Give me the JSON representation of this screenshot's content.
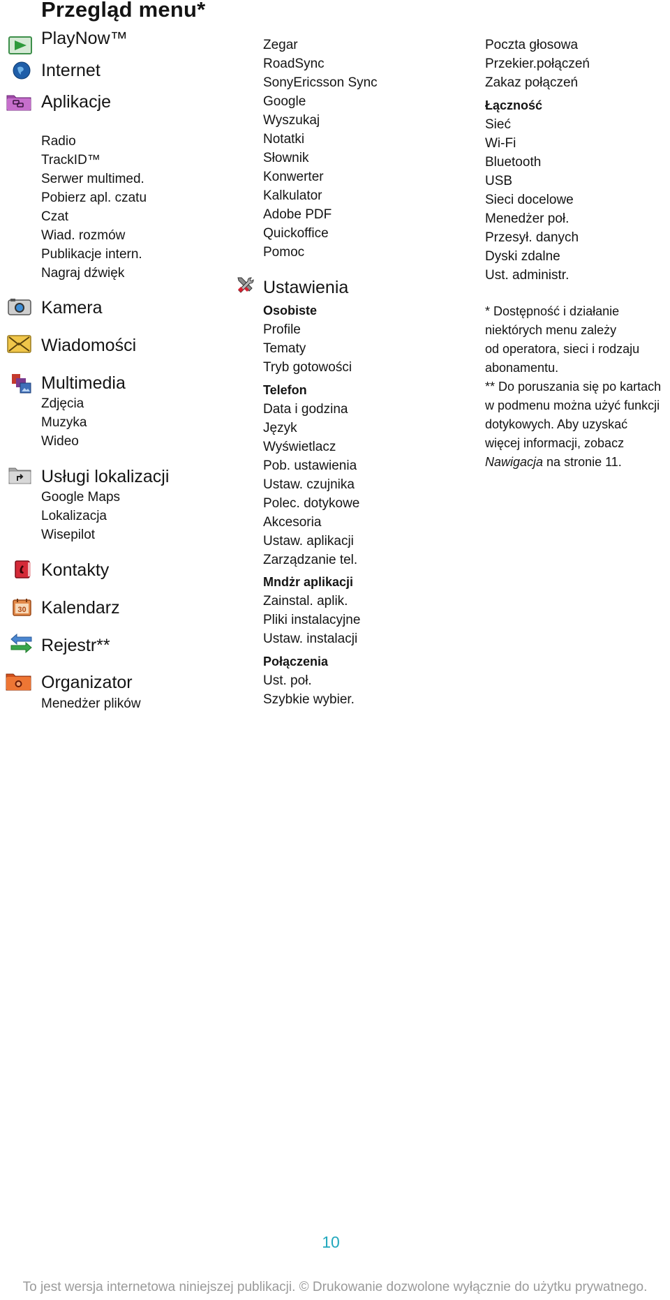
{
  "page": {
    "title": "Przegląd menu*",
    "page_number": "10",
    "footer": "To jest wersja internetowa niniejszej publikacji. © Drukowanie dozwolone wyłącznie do użytku prywatnego."
  },
  "menu": {
    "playnow": {
      "label": "PlayNow™",
      "icon": "playnow-icon"
    },
    "internet": {
      "label": "Internet",
      "icon": "globe-icon"
    },
    "aplikacje": {
      "label": "Aplikacje",
      "icon": "applications-folder-icon",
      "items": [
        "Radio",
        "TrackID™",
        "Serwer multimed.",
        "Pobierz apl. czatu",
        "Czat",
        "Wiad. rozmów",
        "Publikacje intern.",
        "Nagraj dźwięk",
        "Zegar",
        "RoadSync",
        "SonyEricsson Sync",
        "Google",
        "Wyszukaj",
        "Notatki",
        "Słownik",
        "Konwerter",
        "Kalkulator",
        "Adobe PDF",
        "Quickoffice",
        "Pomoc"
      ]
    },
    "kamera": {
      "label": "Kamera",
      "icon": "camera-icon"
    },
    "wiadomosci": {
      "label": "Wiadomości",
      "icon": "envelope-icon"
    },
    "multimedia": {
      "label": "Multimedia",
      "icon": "multimedia-icon",
      "items": [
        "Zdjęcia",
        "Muzyka",
        "Wideo"
      ]
    },
    "uslugi": {
      "label": "Usługi lokalizacji",
      "icon": "location-folder-icon",
      "items": [
        "Google Maps",
        "Lokalizacja",
        "Wisepilot"
      ]
    },
    "kontakty": {
      "label": "Kontakty",
      "icon": "phonebook-icon"
    },
    "kalendarz": {
      "label": "Kalendarz",
      "icon": "calendar-icon",
      "icon_text": "30"
    },
    "rejestr": {
      "label": "Rejestr**",
      "icon": "arrows-exchange-icon"
    },
    "organizator": {
      "label": "Organizator",
      "icon": "organizer-folder-icon",
      "items": [
        "Menedżer plików"
      ]
    },
    "ustawienia": {
      "label": "Ustawienia",
      "icon": "tools-icon",
      "groups": [
        {
          "heading": "Osobiste",
          "items": [
            "Profile",
            "Tematy",
            "Tryb gotowości"
          ]
        },
        {
          "heading": "Telefon",
          "items": [
            "Data i godzina",
            "Język",
            "Wyświetlacz",
            "Pob. ustawienia",
            "Ustaw. czujnika",
            "Polec. dotykowe",
            "Akcesoria",
            "Ustaw. aplikacji",
            "Zarządzanie tel."
          ]
        },
        {
          "heading": "Mndżr aplikacji",
          "items": [
            "Zainstal. aplik.",
            "Pliki instalacyjne",
            "Ustaw. instalacji"
          ]
        },
        {
          "heading": "Połączenia",
          "items": [
            "Ust. poł.",
            "Szybkie wybier.",
            "Poczta głosowa",
            "Przekier.połączeń",
            "Zakaz połączeń"
          ]
        },
        {
          "heading": "Łączność",
          "items": [
            "Sieć",
            "Wi-Fi",
            "Bluetooth",
            "USB",
            "Sieci docelowe",
            "Menedżer poł.",
            "Przesył. danych",
            "Dyski zdalne",
            "Ust. administr."
          ]
        }
      ]
    }
  },
  "notes": {
    "note1": [
      "* Dostępność i działanie",
      "niektórych menu zależy",
      "od operatora, sieci i rodzaju",
      "abonamentu."
    ],
    "note2": [
      "** Do poruszania się po kartach",
      "w podmenu można użyć funkcji",
      "dotykowych. Aby uzyskać",
      "więcej informacji, zobacz"
    ],
    "note2_link": "Nawigacja",
    "note2_tail": " na stronie 11."
  },
  "colors": {
    "accent": "#22a8bd",
    "text": "#141414",
    "footer": "#9a9a9a"
  }
}
